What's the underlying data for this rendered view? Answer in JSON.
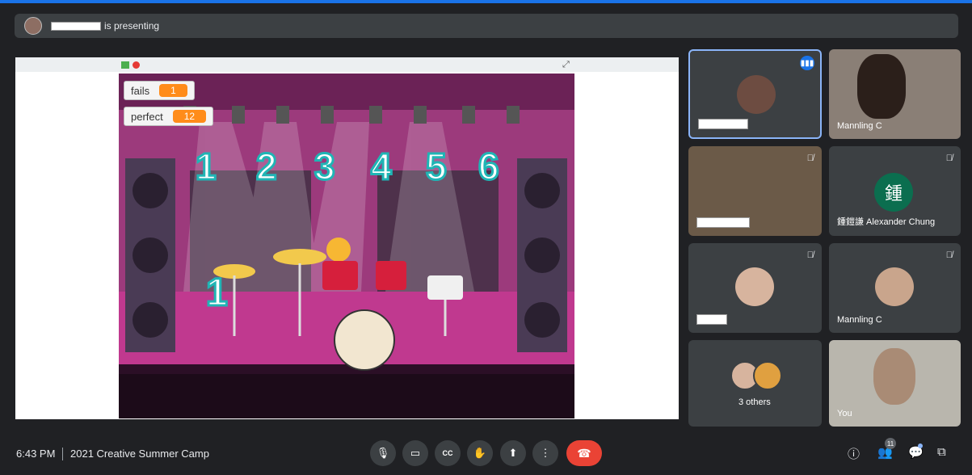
{
  "presenting": {
    "label": "is presenting"
  },
  "game": {
    "fails_label": "fails",
    "fails_value": "1",
    "perfect_label": "perfect",
    "perfect_value": "12",
    "lane_numbers": [
      "1",
      "2",
      "3",
      "4",
      "5",
      "6"
    ],
    "hit_number": "1",
    "fullscreen_icon": "expand-icon"
  },
  "tiles": [
    {
      "name": "",
      "state": "speaking"
    },
    {
      "name": "Mannling C"
    },
    {
      "name": "",
      "state": "muted"
    },
    {
      "name": "鍾鎧謙 Alexander Chung",
      "avatar_letter": "鍾",
      "state": "muted"
    },
    {
      "name": "",
      "state": "muted"
    },
    {
      "name": "Mannling C",
      "state": "muted"
    },
    {
      "name": "3 others"
    },
    {
      "name": "You"
    }
  ],
  "bottom": {
    "time": "6:43 PM",
    "meeting_title": "2021 Creative Summer Camp",
    "participants_count": "11"
  },
  "colors": {
    "accent": "#1a73e8",
    "end_call": "#ea4335",
    "tile_bg": "#3c4043",
    "background": "#202124"
  }
}
